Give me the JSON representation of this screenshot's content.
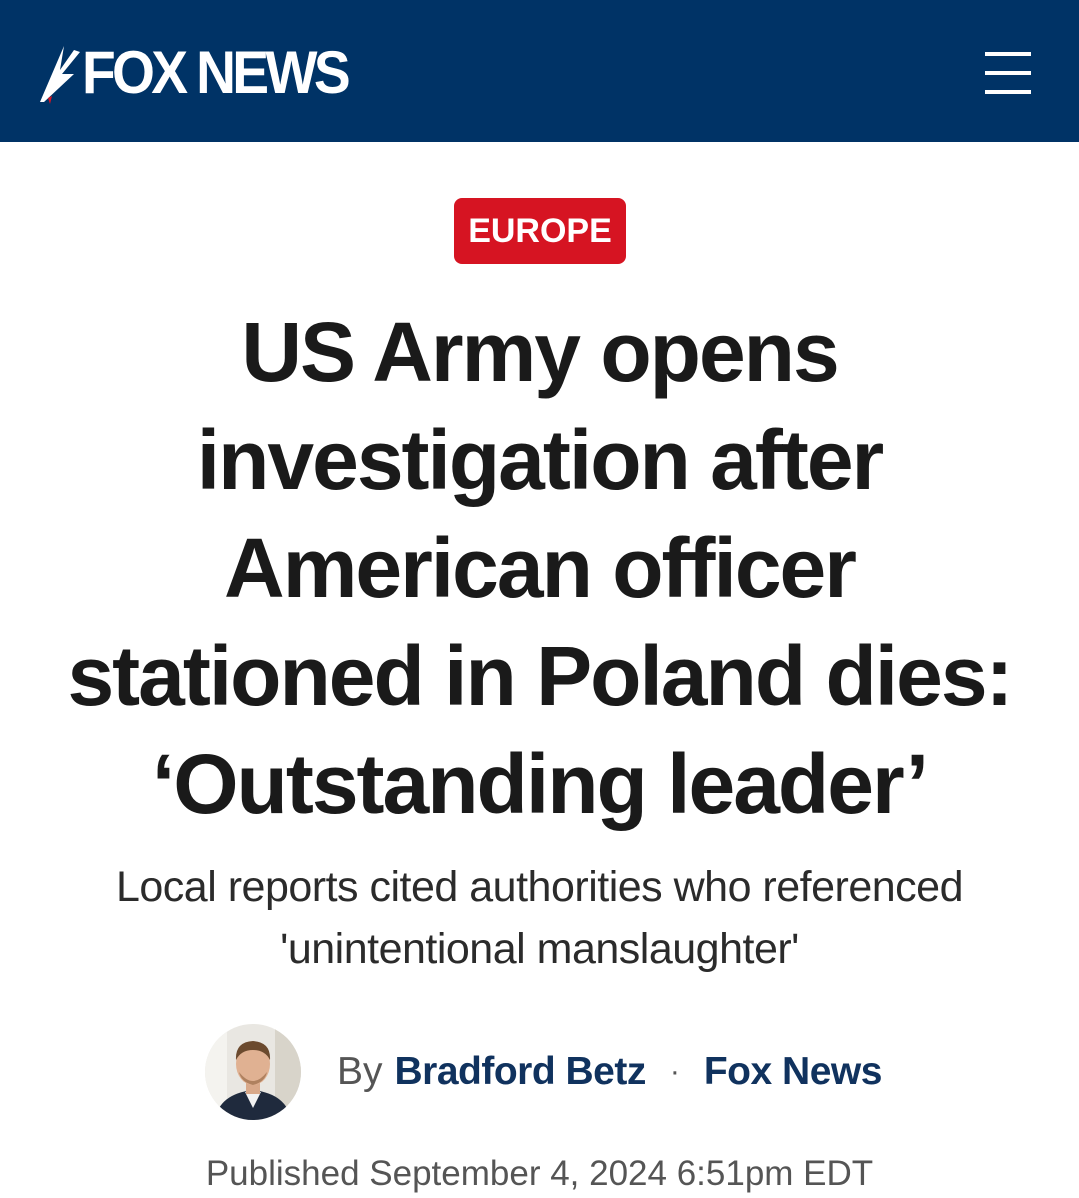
{
  "header": {
    "logo_text": "FOX NEWS",
    "background_color": "#003366",
    "menu_icon": "hamburger-menu-icon"
  },
  "article": {
    "category": "EUROPE",
    "category_color": "#d61422",
    "headline_lines": [
      "US Army opens",
      "investigation after",
      "American officer",
      "stationed in Poland dies:",
      "‘Outstanding leader’"
    ],
    "subhead_lines": [
      "Local reports cited authorities who referenced",
      "'unintentional manslaughter'"
    ],
    "byline": {
      "prefix": "By",
      "author": "Bradford Betz",
      "separator": "·",
      "source": "Fox News"
    },
    "published": "Published September 4, 2024 6:51pm EDT"
  }
}
